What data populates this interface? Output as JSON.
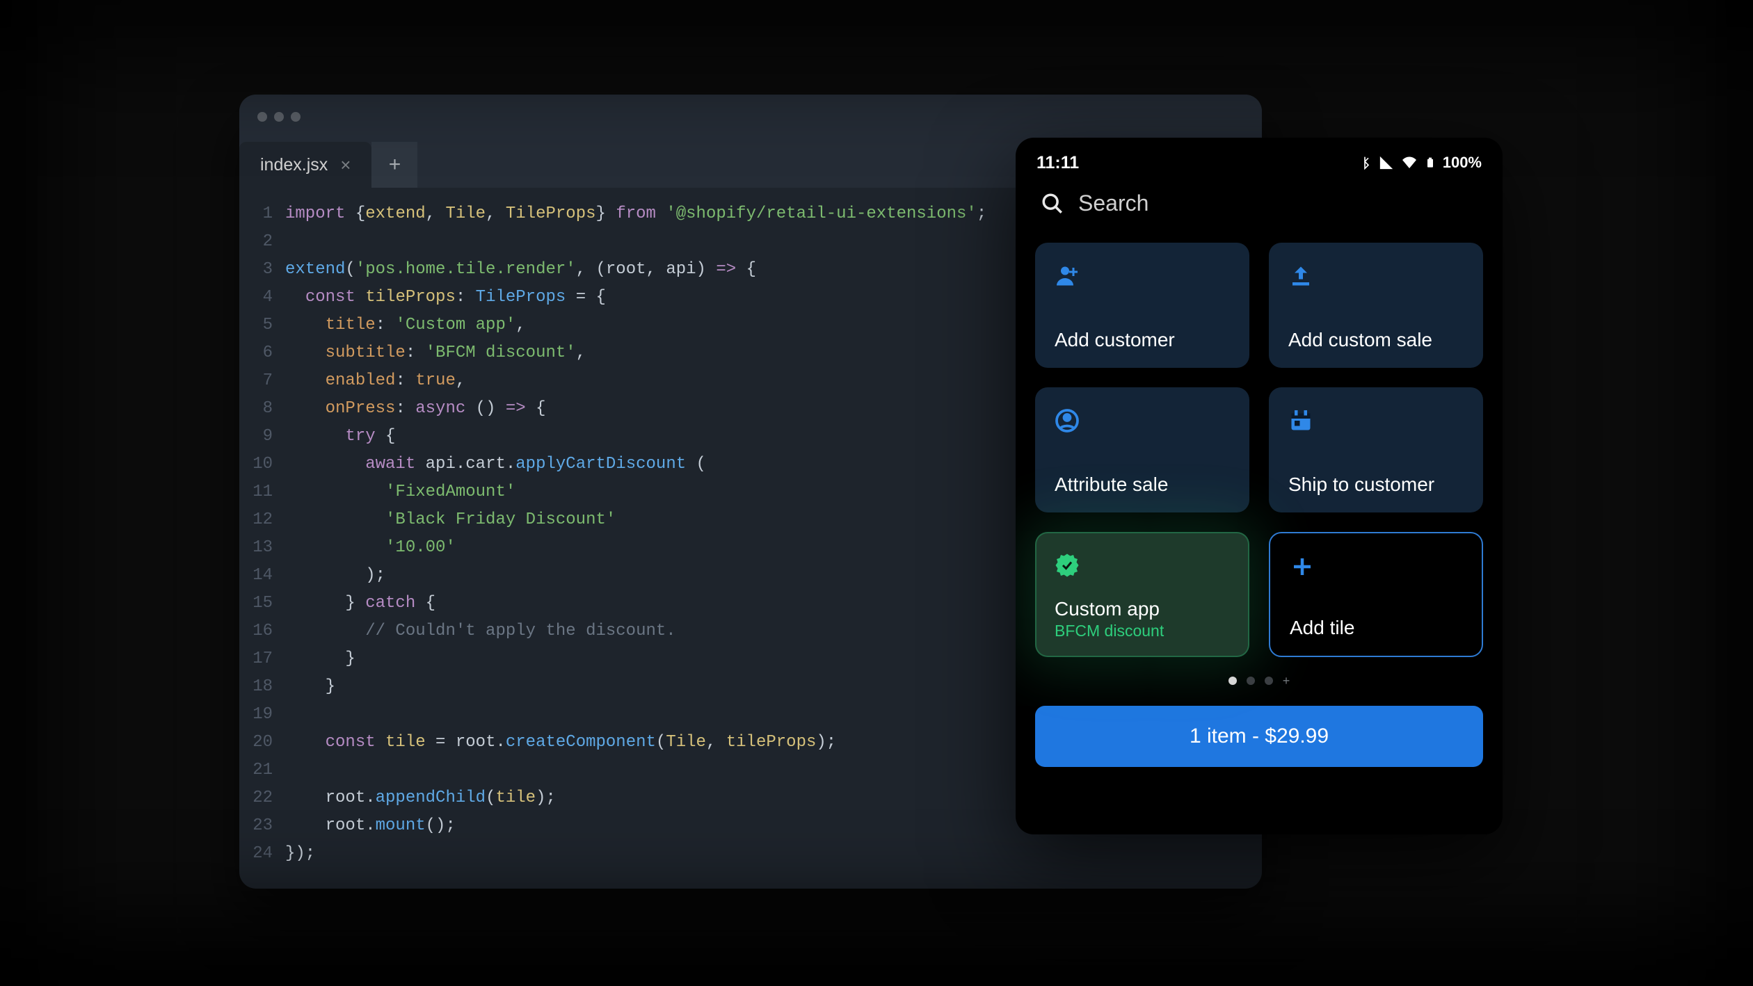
{
  "editor": {
    "tab_filename": "index.jsx",
    "code_lines": [
      {
        "n": 1,
        "tokens": [
          [
            "kw",
            "import "
          ],
          [
            "punc",
            "{"
          ],
          [
            "id",
            "extend"
          ],
          [
            "punc",
            ", "
          ],
          [
            "id",
            "Tile"
          ],
          [
            "punc",
            ", "
          ],
          [
            "id",
            "TileProps"
          ],
          [
            "punc",
            "} "
          ],
          [
            "kw",
            "from "
          ],
          [
            "str",
            "'@shopify/retail-ui-extensions'"
          ],
          [
            "punc",
            ";"
          ]
        ]
      },
      {
        "n": 2,
        "tokens": []
      },
      {
        "n": 3,
        "tokens": [
          [
            "fn",
            "extend"
          ],
          [
            "punc",
            "("
          ],
          [
            "str",
            "'pos.home.tile.render'"
          ],
          [
            "punc",
            ", ("
          ],
          [
            "obj",
            "root"
          ],
          [
            "punc",
            ", "
          ],
          [
            "obj",
            "api"
          ],
          [
            "punc",
            ") "
          ],
          [
            "kw",
            "=>"
          ],
          [
            "punc",
            " {"
          ]
        ]
      },
      {
        "n": 4,
        "tokens": [
          [
            "punc",
            "  "
          ],
          [
            "kw",
            "const "
          ],
          [
            "id",
            "tileProps"
          ],
          [
            "punc",
            ": "
          ],
          [
            "type",
            "TileProps"
          ],
          [
            "punc",
            " = {"
          ]
        ]
      },
      {
        "n": 5,
        "tokens": [
          [
            "punc",
            "    "
          ],
          [
            "prop",
            "title"
          ],
          [
            "punc",
            ": "
          ],
          [
            "str",
            "'Custom app'"
          ],
          [
            "punc",
            ","
          ]
        ]
      },
      {
        "n": 6,
        "tokens": [
          [
            "punc",
            "    "
          ],
          [
            "prop",
            "subtitle"
          ],
          [
            "punc",
            ": "
          ],
          [
            "str",
            "'BFCM discount'"
          ],
          [
            "punc",
            ","
          ]
        ]
      },
      {
        "n": 7,
        "tokens": [
          [
            "punc",
            "    "
          ],
          [
            "prop",
            "enabled"
          ],
          [
            "punc",
            ": "
          ],
          [
            "bool",
            "true"
          ],
          [
            "punc",
            ","
          ]
        ]
      },
      {
        "n": 8,
        "tokens": [
          [
            "punc",
            "    "
          ],
          [
            "prop",
            "onPress"
          ],
          [
            "punc",
            ": "
          ],
          [
            "kw",
            "async"
          ],
          [
            "punc",
            " () "
          ],
          [
            "kw",
            "=>"
          ],
          [
            "punc",
            " {"
          ]
        ]
      },
      {
        "n": 9,
        "tokens": [
          [
            "punc",
            "      "
          ],
          [
            "kw",
            "try"
          ],
          [
            "punc",
            " {"
          ]
        ]
      },
      {
        "n": 10,
        "tokens": [
          [
            "punc",
            "        "
          ],
          [
            "kw",
            "await "
          ],
          [
            "obj",
            "api"
          ],
          [
            "punc",
            "."
          ],
          [
            "obj",
            "cart"
          ],
          [
            "punc",
            "."
          ],
          [
            "fn",
            "applyCartDiscount"
          ],
          [
            "punc",
            " ("
          ]
        ]
      },
      {
        "n": 11,
        "tokens": [
          [
            "punc",
            "          "
          ],
          [
            "str",
            "'FixedAmount'"
          ]
        ]
      },
      {
        "n": 12,
        "tokens": [
          [
            "punc",
            "          "
          ],
          [
            "str",
            "'Black Friday Discount'"
          ]
        ]
      },
      {
        "n": 13,
        "tokens": [
          [
            "punc",
            "          "
          ],
          [
            "str",
            "'10.00'"
          ]
        ]
      },
      {
        "n": 14,
        "tokens": [
          [
            "punc",
            "        );"
          ]
        ]
      },
      {
        "n": 15,
        "tokens": [
          [
            "punc",
            "      } "
          ],
          [
            "kw",
            "catch"
          ],
          [
            "punc",
            " {"
          ]
        ]
      },
      {
        "n": 16,
        "tokens": [
          [
            "punc",
            "        "
          ],
          [
            "cmt",
            "// Couldn't apply the discount."
          ]
        ]
      },
      {
        "n": 17,
        "tokens": [
          [
            "punc",
            "      }"
          ]
        ]
      },
      {
        "n": 18,
        "tokens": [
          [
            "punc",
            "    }"
          ]
        ]
      },
      {
        "n": 19,
        "tokens": []
      },
      {
        "n": 20,
        "tokens": [
          [
            "punc",
            "    "
          ],
          [
            "kw",
            "const "
          ],
          [
            "id",
            "tile"
          ],
          [
            "punc",
            " = "
          ],
          [
            "obj",
            "root"
          ],
          [
            "punc",
            "."
          ],
          [
            "fn",
            "createComponent"
          ],
          [
            "punc",
            "("
          ],
          [
            "id",
            "Tile"
          ],
          [
            "punc",
            ", "
          ],
          [
            "id",
            "tileProps"
          ],
          [
            "punc",
            ");"
          ]
        ]
      },
      {
        "n": 21,
        "tokens": []
      },
      {
        "n": 22,
        "tokens": [
          [
            "punc",
            "    "
          ],
          [
            "obj",
            "root"
          ],
          [
            "punc",
            "."
          ],
          [
            "fn",
            "appendChild"
          ],
          [
            "punc",
            "("
          ],
          [
            "id",
            "tile"
          ],
          [
            "punc",
            ");"
          ]
        ]
      },
      {
        "n": 23,
        "tokens": [
          [
            "punc",
            "    "
          ],
          [
            "obj",
            "root"
          ],
          [
            "punc",
            "."
          ],
          [
            "fn",
            "mount"
          ],
          [
            "punc",
            "();"
          ]
        ]
      },
      {
        "n": 24,
        "tokens": [
          [
            "punc",
            "});"
          ]
        ]
      }
    ]
  },
  "phone": {
    "status_time": "11:11",
    "status_battery": "100%",
    "search_placeholder": "Search",
    "tiles": {
      "add_customer": "Add customer",
      "add_custom_sale": "Add custom sale",
      "attribute_sale": "Attribute sale",
      "ship_to_customer": "Ship to customer",
      "custom_app_title": "Custom app",
      "custom_app_subtitle": "BFCM discount",
      "add_tile": "Add tile"
    },
    "checkout_label": "1 item - $29.99"
  }
}
